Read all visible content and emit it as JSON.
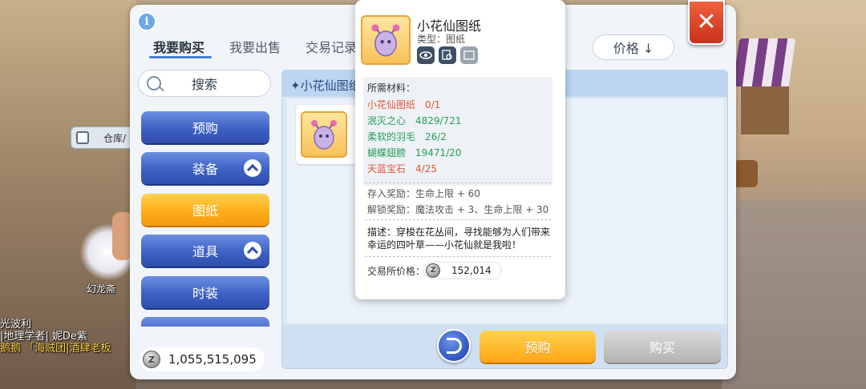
{
  "tabs": [
    {
      "label": "我要购买",
      "active": true
    },
    {
      "label": "我要出售",
      "active": false
    },
    {
      "label": "交易记录",
      "active": false
    }
  ],
  "sort_button": "价格 ↓",
  "close_icon": "close-x-icon",
  "search": {
    "label": "搜索",
    "icon": "search-icon"
  },
  "categories": [
    {
      "label": "预购",
      "selected": false,
      "chevron": false
    },
    {
      "label": "装备",
      "selected": false,
      "chevron": true
    },
    {
      "label": "图纸",
      "selected": true,
      "chevron": false
    },
    {
      "label": "道具",
      "selected": false,
      "chevron": true
    },
    {
      "label": "时装",
      "selected": false,
      "chevron": false
    }
  ],
  "balance": "1,055,515,095",
  "list_title": "✦小花仙图纸",
  "buttons": {
    "preorder": "预购",
    "buy": "购买"
  },
  "tooltip": {
    "name": "小花仙图纸",
    "type": "类型：图纸",
    "materials_title": "所需材料：",
    "materials": [
      {
        "name": "小花仙图纸",
        "qty": "0/1",
        "color": "#e4583c"
      },
      {
        "name": "泯灭之心",
        "qty": "4829/721",
        "color": "#23a05a"
      },
      {
        "name": "柔软的羽毛",
        "qty": "26/2",
        "color": "#23a05a"
      },
      {
        "name": "蝴蝶翅膀",
        "qty": "19471/20",
        "color": "#23a05a"
      },
      {
        "name": "天蓝宝石",
        "qty": "4/25",
        "color": "#e4583c"
      }
    ],
    "deposit_reward": "存入奖励：生命上限 + 60",
    "unlock_reward": "解锁奖励：魔法攻击 + 3、生命上限 + 30",
    "description": "描述：穿梭在花丛间，寻找能够为人们带来幸运的四叶草——小花仙就是我啦！",
    "price_label": "交易所价格：",
    "price": "152,014"
  },
  "background": {
    "warehouse_label": "仓库/",
    "npc_name": "幻龙斋",
    "chat_lines": [
      "光波利",
      "|地理学者| 妮De紫",
      "鹅鹅 「海贼团|酒肆老板"
    ]
  }
}
